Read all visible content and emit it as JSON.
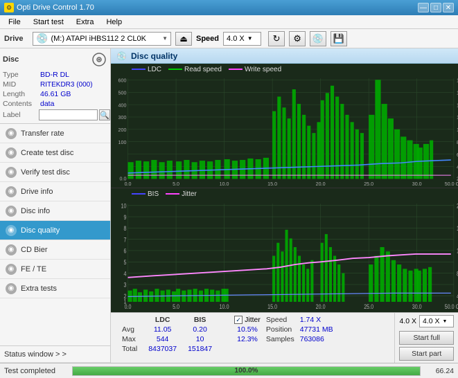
{
  "app": {
    "title": "Opti Drive Control 1.70",
    "icon": "⚙"
  },
  "titlebar": {
    "buttons": {
      "minimize": "—",
      "maximize": "□",
      "close": "✕"
    }
  },
  "menubar": {
    "items": [
      "File",
      "Start test",
      "Extra",
      "Help"
    ]
  },
  "drivebar": {
    "drive_label": "Drive",
    "drive_value": "(M:)  ATAPI iHBS112  2 CL0K",
    "speed_label": "Speed",
    "speed_value": "4.0 X"
  },
  "disc": {
    "title": "Disc",
    "type_label": "Type",
    "type_value": "BD-R DL",
    "mid_label": "MID",
    "mid_value": "RITEKDR3 (000)",
    "length_label": "Length",
    "length_value": "46.61 GB",
    "contents_label": "Contents",
    "contents_value": "data",
    "label_label": "Label",
    "label_value": ""
  },
  "sidebar": {
    "nav_items": [
      {
        "id": "transfer-rate",
        "label": "Transfer rate",
        "active": false
      },
      {
        "id": "create-test-disc",
        "label": "Create test disc",
        "active": false
      },
      {
        "id": "verify-test-disc",
        "label": "Verify test disc",
        "active": false
      },
      {
        "id": "drive-info",
        "label": "Drive info",
        "active": false
      },
      {
        "id": "disc-info",
        "label": "Disc info",
        "active": false
      },
      {
        "id": "disc-quality",
        "label": "Disc quality",
        "active": true
      },
      {
        "id": "cd-bier",
        "label": "CD Bier",
        "active": false
      },
      {
        "id": "fe-te",
        "label": "FE / TE",
        "active": false
      },
      {
        "id": "extra-tests",
        "label": "Extra tests",
        "active": false
      }
    ],
    "status_window": "Status window > >"
  },
  "status_bar_bottom": {
    "status_text": "Test completed",
    "progress": "100.0%",
    "value": "66.24"
  },
  "disc_quality": {
    "title": "Disc quality",
    "legend_top": [
      "LDC",
      "Read speed",
      "Write speed"
    ],
    "legend_bottom": [
      "BIS",
      "Jitter"
    ],
    "stats": {
      "headers": [
        "LDC",
        "BIS",
        "",
        "Jitter",
        "Speed",
        ""
      ],
      "avg": {
        "ldc": "11.05",
        "bis": "0.20",
        "jitter": "10.5%"
      },
      "max": {
        "ldc": "544",
        "bis": "10",
        "jitter": "12.3%"
      },
      "total": {
        "ldc": "8437037",
        "bis": "151847"
      },
      "speed_label": "Speed",
      "speed_value": "1.74 X",
      "speed_select": "4.0 X",
      "position_label": "Position",
      "position_value": "47731 MB",
      "samples_label": "Samples",
      "samples_value": "763086",
      "jitter_checked": true
    },
    "buttons": {
      "start_full": "Start full",
      "start_part": "Start part"
    },
    "row_labels": [
      "Avg",
      "Max",
      "Total"
    ]
  }
}
